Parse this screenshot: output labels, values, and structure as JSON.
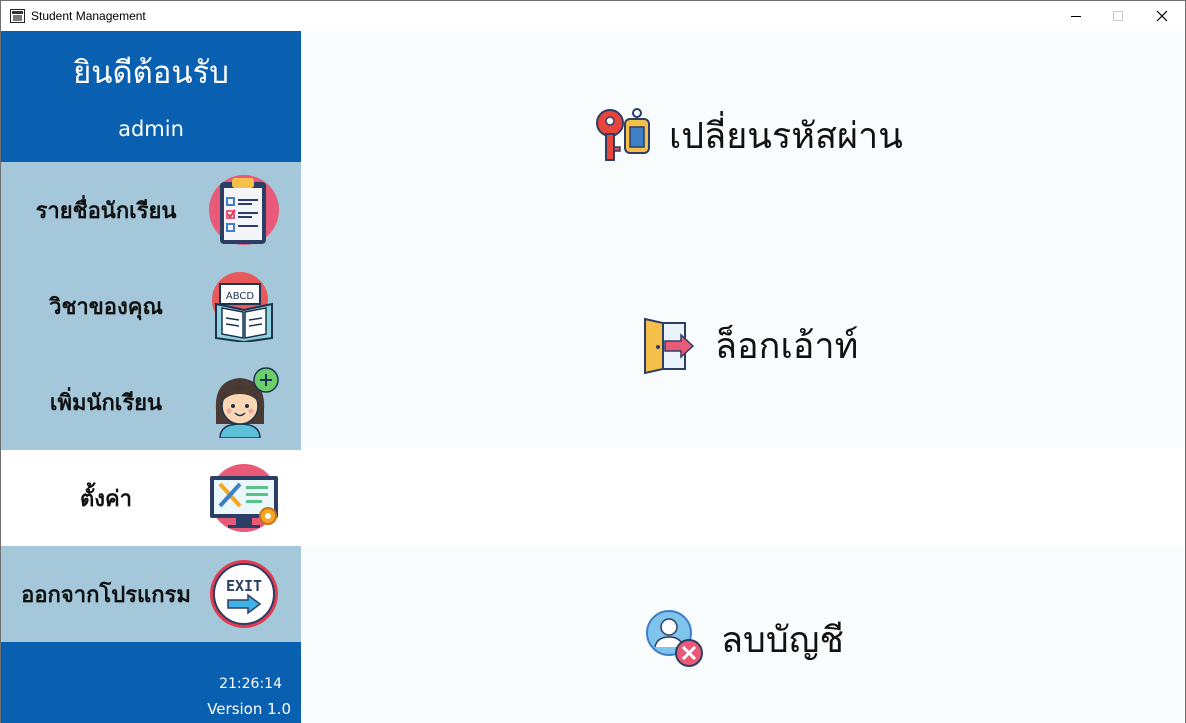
{
  "window": {
    "title": "Student Management",
    "minimize_icon": "minimize-icon",
    "maximize_icon": "maximize-icon",
    "close_icon": "close-icon"
  },
  "sidebar": {
    "welcome": "ยินดีต้อนรับ",
    "username": "admin",
    "items": [
      {
        "label": "รายชื่อนักเรียน",
        "icon": "clipboard-checklist-icon"
      },
      {
        "label": "วิชาของคุณ",
        "icon": "abcd-book-icon"
      },
      {
        "label": "เพิ่มนักเรียน",
        "icon": "add-student-icon"
      },
      {
        "label": "ตั้งค่า",
        "icon": "settings-monitor-icon",
        "active": true
      },
      {
        "label": "ออกจากโปรแกรม",
        "icon": "exit-sign-icon"
      }
    ],
    "clock": "21:26:14",
    "version": "Version 1.0"
  },
  "main": {
    "actions": [
      {
        "label": "เปลี่ยนรหัสผ่าน",
        "icon": "keys-icon"
      },
      {
        "label": "ล็อกเอ้าท์",
        "icon": "logout-door-icon"
      },
      {
        "label": "ลบบัญชี",
        "icon": "delete-account-icon"
      }
    ]
  },
  "colors": {
    "sidebar_header": "#0a60b0",
    "menu_bg": "#a4c7d9",
    "menu_active_bg": "#ffffff",
    "content_bg": "#f8fcfc"
  }
}
